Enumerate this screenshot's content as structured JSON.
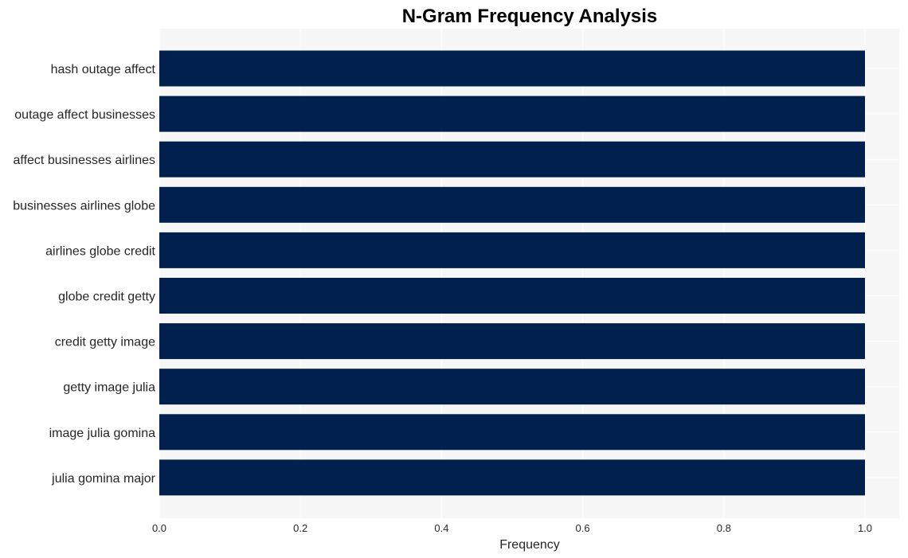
{
  "chart_data": {
    "type": "bar",
    "orientation": "horizontal",
    "title": "N-Gram Frequency Analysis",
    "xlabel": "Frequency",
    "ylabel": "",
    "categories": [
      "hash outage affect",
      "outage affect businesses",
      "affect businesses airlines",
      "businesses airlines globe",
      "airlines globe credit",
      "globe credit getty",
      "credit getty image",
      "getty image julia",
      "image julia gomina",
      "julia gomina major"
    ],
    "values": [
      1,
      1,
      1,
      1,
      1,
      1,
      1,
      1,
      1,
      1
    ],
    "xlim": [
      0,
      1.05
    ],
    "xticks": [
      0.0,
      0.2,
      0.4,
      0.6,
      0.8,
      1.0
    ],
    "xtick_labels": [
      "0.0",
      "0.2",
      "0.4",
      "0.6",
      "0.8",
      "1.0"
    ],
    "grid": true,
    "legend": "none",
    "colors": {
      "bar": "#00214e",
      "plot_background": "#f7f7f7",
      "grid": "#ffffff",
      "text": "#262626"
    }
  }
}
